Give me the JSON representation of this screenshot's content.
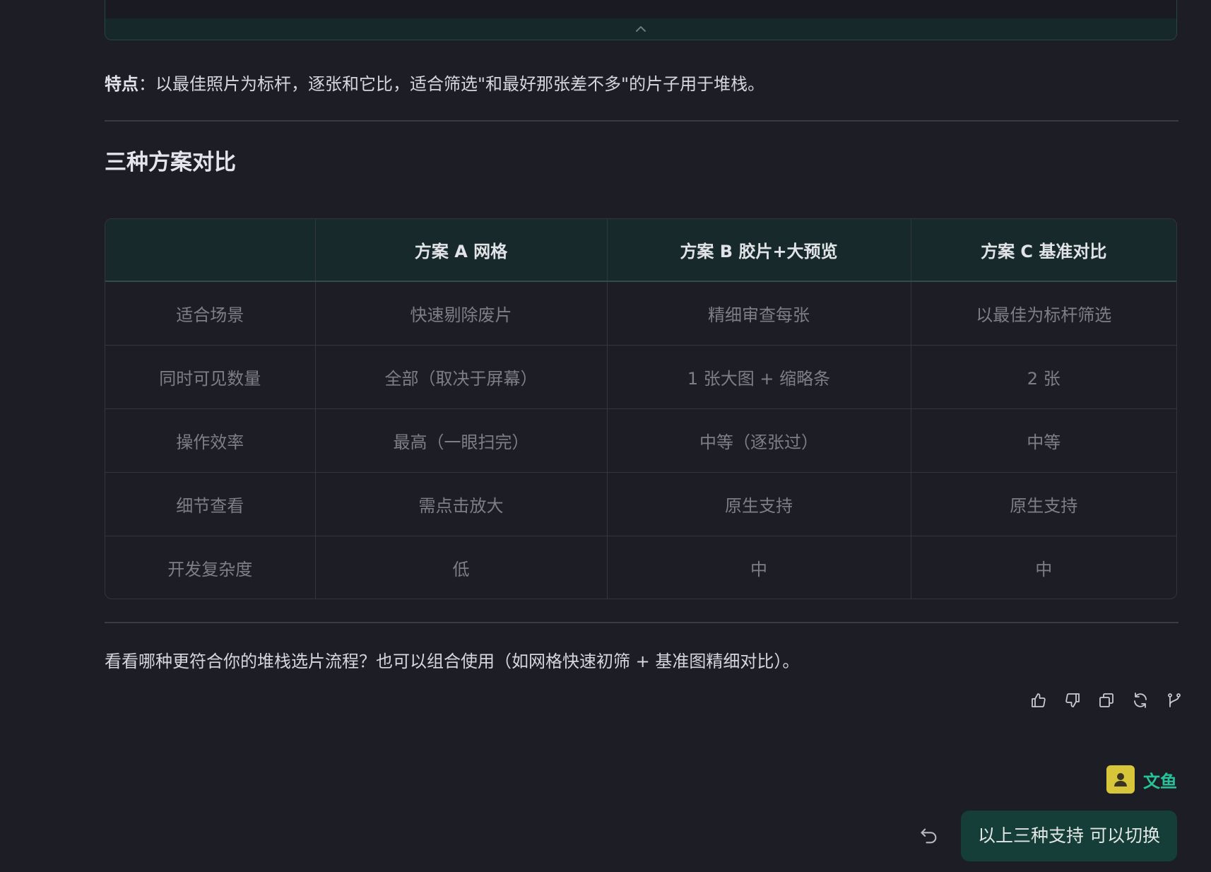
{
  "feature_note": {
    "label": "特点",
    "text": "：以最佳照片为标杆，逐张和它比，适合筛选\"和最好那张差不多\"的片子用于堆栈。"
  },
  "section_title": "三种方案对比",
  "comparison_table": {
    "headers": [
      "",
      "方案 A 网格",
      "方案 B 胶片+大预览",
      "方案 C 基准对比"
    ],
    "rows": [
      [
        "适合场景",
        "快速剔除废片",
        "精细审查每张",
        "以最佳为标杆筛选"
      ],
      [
        "同时可见数量",
        "全部（取决于屏幕）",
        "1 张大图 + 缩略条",
        "2 张"
      ],
      [
        "操作效率",
        "最高（一眼扫完）",
        "中等（逐张过）",
        "中等"
      ],
      [
        "细节查看",
        "需点击放大",
        "原生支持",
        "原生支持"
      ],
      [
        "开发复杂度",
        "低",
        "中",
        "中"
      ]
    ]
  },
  "closing_text": "看看哪种更符合你的堆栈选片流程？也可以组合使用（如网格快速初筛 + 基准图精细对比）。",
  "actions": {
    "icons": [
      "thumbs-up-icon",
      "thumbs-down-icon",
      "copy-icon",
      "refresh-icon",
      "branch-icon"
    ]
  },
  "user": {
    "name": "文鱼",
    "message": "以上三种支持 可以切换"
  },
  "colors": {
    "background": "#1c1d25",
    "accent": "#26c39a",
    "bubble": "#143e37",
    "table_header": "#18292b",
    "avatar": "#d8c63a"
  }
}
